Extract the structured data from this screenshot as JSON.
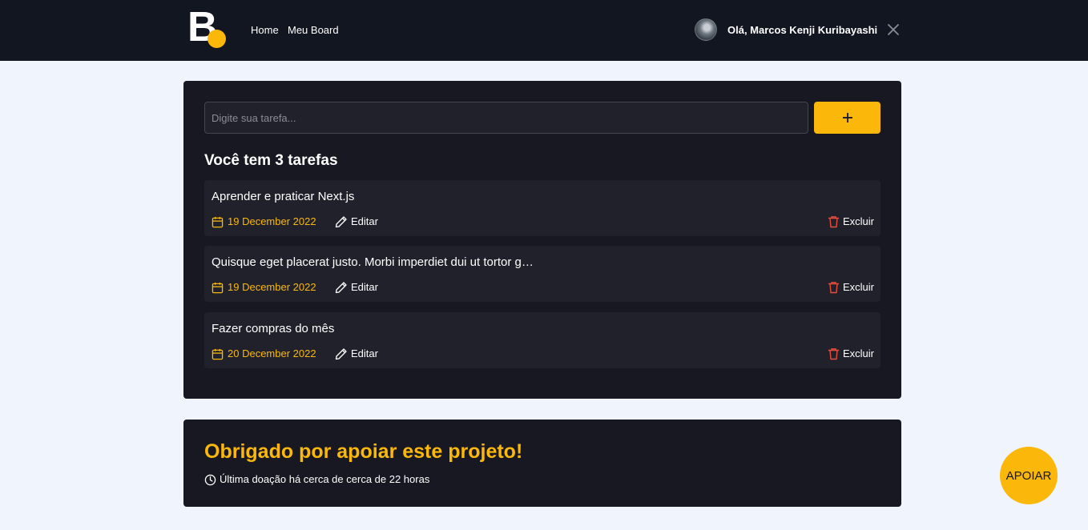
{
  "header": {
    "logo_letter": "B",
    "nav": [
      {
        "label": "Home"
      },
      {
        "label": "Meu Board"
      }
    ],
    "greeting": "Olá, Marcos Kenji Kuribayashi"
  },
  "board": {
    "input_placeholder": "Digite sua tarefa...",
    "input_value": "",
    "count_text": "Você tem 3 tarefas",
    "tasks": [
      {
        "title": "Aprender e praticar Next.js",
        "date": "19 December 2022",
        "edit_label": "Editar",
        "delete_label": "Excluir"
      },
      {
        "title": "Quisque eget placerat justo. Morbi imperdiet dui ut tortor g…",
        "date": "19 December 2022",
        "edit_label": "Editar",
        "delete_label": "Excluir"
      },
      {
        "title": "Fazer compras do mês",
        "date": "20 December 2022",
        "edit_label": "Editar",
        "delete_label": "Excluir"
      }
    ]
  },
  "support": {
    "title": "Obrigado por apoiar este projeto!",
    "last_donation": "Última doação há cerca de cerca de 22 horas",
    "button_label": "APOIAR"
  },
  "colors": {
    "accent": "#fbb80a",
    "header_bg": "#121620",
    "card_bg": "#171821",
    "task_bg": "#20212b",
    "page_bg": "#f0f4fc",
    "delete_icon": "#e74c3c"
  },
  "icons": {
    "add": "plus-icon",
    "date": "calendar-icon",
    "edit": "pencil-icon",
    "delete": "trash-icon",
    "logout": "close-icon",
    "time": "clock-icon"
  }
}
